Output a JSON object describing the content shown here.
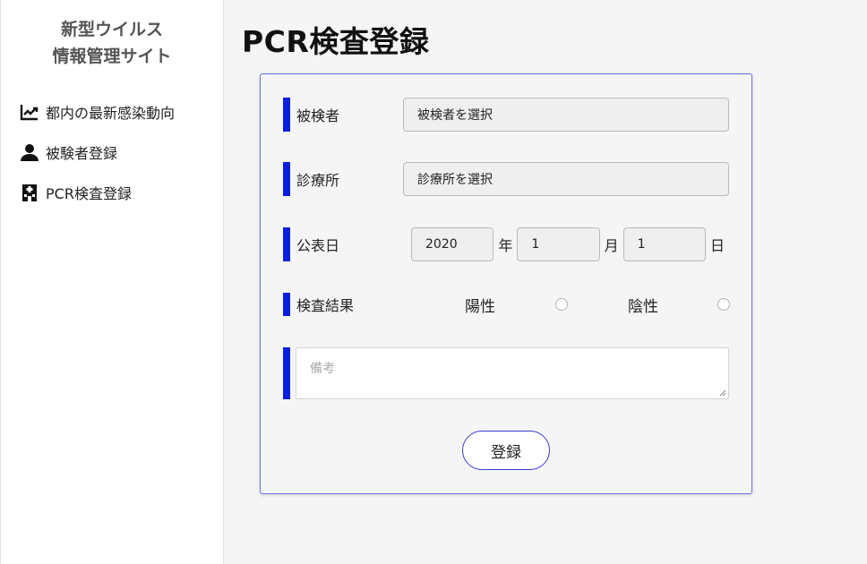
{
  "sidebar": {
    "brand_line1": "新型ウイルス",
    "brand_line2": "情報管理サイト",
    "items": [
      {
        "label": "都内の最新感染動向",
        "icon": "trending-chart-icon"
      },
      {
        "label": "被験者登録",
        "icon": "person-icon"
      },
      {
        "label": "PCR検査登録",
        "icon": "hospital-building-icon"
      }
    ]
  },
  "page": {
    "title": "PCR検査登録"
  },
  "form": {
    "subject": {
      "label": "被検者",
      "value": "被検者を選択"
    },
    "clinic": {
      "label": "診療所",
      "value": "診療所を選択"
    },
    "date": {
      "label": "公表日",
      "year": "2020",
      "year_unit": "年",
      "month": "1",
      "month_unit": "月",
      "day": "1",
      "day_unit": "日"
    },
    "result": {
      "label": "検査結果",
      "positive": "陽性",
      "negative": "陰性"
    },
    "memo": {
      "placeholder": "備考"
    },
    "submit_label": "登録"
  },
  "colors": {
    "accent_bar": "#0a1ee0",
    "card_border": "#6f6fe8",
    "button_border": "#3b3bd8"
  }
}
